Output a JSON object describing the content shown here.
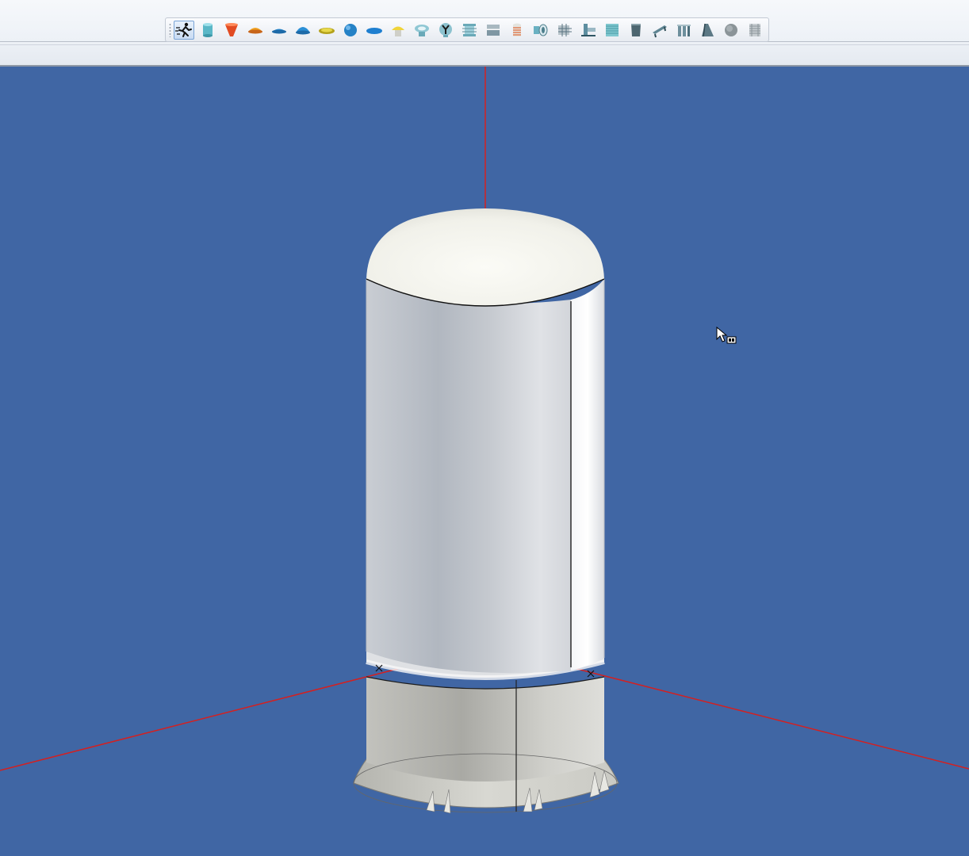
{
  "window": {
    "background_color": "#4066a4",
    "toolbar_bg": "#eef2f7"
  },
  "toolbar": {
    "buttons": [
      {
        "name": "run-icon",
        "active": true
      },
      {
        "name": "cylinder-icon"
      },
      {
        "name": "cone-icon"
      },
      {
        "name": "ellipsoidal-head-icon"
      },
      {
        "name": "flat-dish-head-icon"
      },
      {
        "name": "hemispherical-head-icon"
      },
      {
        "name": "flanged-head-icon"
      },
      {
        "name": "sphere-icon"
      },
      {
        "name": "flat-cover-icon"
      },
      {
        "name": "nozzle-cap-icon"
      },
      {
        "name": "manway-icon"
      },
      {
        "name": "y-fitting-icon"
      },
      {
        "name": "flange-pair-icon"
      },
      {
        "name": "reducer-icon"
      },
      {
        "name": "bellows-icon"
      },
      {
        "name": "nozzle-icon"
      },
      {
        "name": "tube-bundle-icon"
      },
      {
        "name": "saddle-support-icon"
      },
      {
        "name": "tray-icon"
      },
      {
        "name": "skirt-icon"
      },
      {
        "name": "leg-support-icon"
      },
      {
        "name": "lug-support-icon"
      },
      {
        "name": "ring-support-icon"
      },
      {
        "name": "platform-icon"
      },
      {
        "name": "insulation-icon"
      },
      {
        "name": "ladder-icon"
      }
    ]
  },
  "scene": {
    "axis_color": "#d42020",
    "vessel_color": "#e8eaec",
    "head_color": "#f4f4ef",
    "skirt_color": "#d4d4d0"
  }
}
